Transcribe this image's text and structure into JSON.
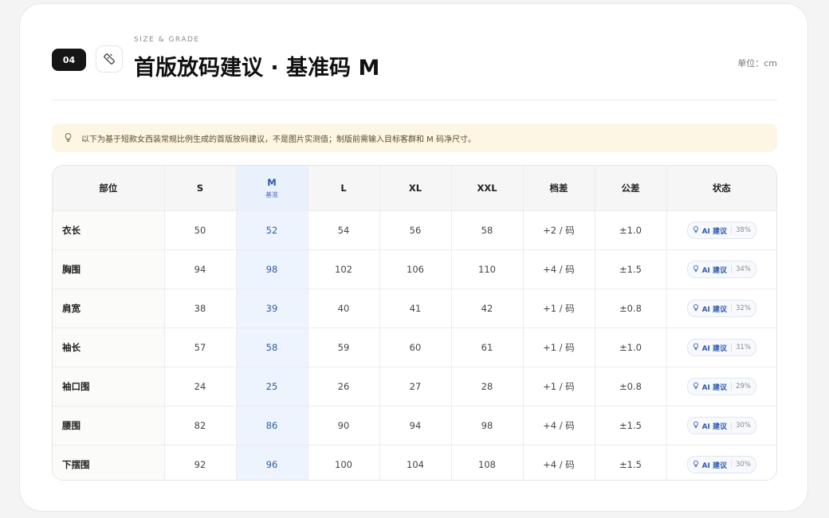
{
  "header": {
    "badge": "04",
    "eyebrow": "SIZE & GRADE",
    "title": "首版放码建议 · 基准码 M",
    "unit": "单位：cm"
  },
  "notice": {
    "text": "以下为基于短款女西装常规比例生成的首版放码建议，不是图片实测值；制版前需输入目标客群和 M 码净尺寸。"
  },
  "table": {
    "headers": {
      "part": "部位",
      "s": "S",
      "m": "M",
      "m_sub": "基准",
      "l": "L",
      "xl": "XL",
      "xxl": "XXL",
      "grade": "档差",
      "tol": "公差",
      "status": "状态"
    },
    "rows": [
      {
        "part": "衣长",
        "s": "50",
        "m": "52",
        "l": "54",
        "xl": "56",
        "xxl": "58",
        "grade": "+2 / 码",
        "tol": "±1.0",
        "status": "AI 建议",
        "pct": "38%"
      },
      {
        "part": "胸围",
        "s": "94",
        "m": "98",
        "l": "102",
        "xl": "106",
        "xxl": "110",
        "grade": "+4 / 码",
        "tol": "±1.5",
        "status": "AI 建议",
        "pct": "34%"
      },
      {
        "part": "肩宽",
        "s": "38",
        "m": "39",
        "l": "40",
        "xl": "41",
        "xxl": "42",
        "grade": "+1 / 码",
        "tol": "±0.8",
        "status": "AI 建议",
        "pct": "32%"
      },
      {
        "part": "袖长",
        "s": "57",
        "m": "58",
        "l": "59",
        "xl": "60",
        "xxl": "61",
        "grade": "+1 / 码",
        "tol": "±1.0",
        "status": "AI 建议",
        "pct": "31%"
      },
      {
        "part": "袖口围",
        "s": "24",
        "m": "25",
        "l": "26",
        "xl": "27",
        "xxl": "28",
        "grade": "+1 / 码",
        "tol": "±0.8",
        "status": "AI 建议",
        "pct": "29%"
      },
      {
        "part": "腰围",
        "s": "82",
        "m": "86",
        "l": "90",
        "xl": "94",
        "xxl": "98",
        "grade": "+4 / 码",
        "tol": "±1.5",
        "status": "AI 建议",
        "pct": "30%"
      },
      {
        "part": "下摆围",
        "s": "92",
        "m": "96",
        "l": "100",
        "xl": "104",
        "xxl": "108",
        "grade": "+4 / 码",
        "tol": "±1.5",
        "status": "AI 建议",
        "pct": "30%"
      }
    ]
  },
  "colors": {
    "accent": "#2e5cab",
    "base_column": "#eef4fd",
    "notice_bg": "#fdf6e5"
  },
  "icons": {
    "header": "ruler-icon",
    "notice": "lightbulb-icon",
    "status": "lightbulb-icon"
  }
}
